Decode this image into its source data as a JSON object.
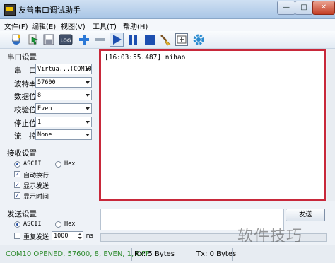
{
  "window": {
    "title": "友善串口调试助手",
    "controls": {
      "minimize": "—",
      "maximize": "□",
      "close": "✕"
    }
  },
  "menu": [
    "文件(F)",
    "编辑(E)",
    "视图(V)",
    "工具(T)",
    "帮助(H)"
  ],
  "toolbar": {
    "icons": [
      "new-doc-icon",
      "open-icon",
      "save-icon",
      "log-icon",
      "add-icon",
      "remove-icon",
      "play-icon",
      "pause-icon",
      "stop-icon",
      "clear-brush-icon",
      "add-window-icon",
      "settings-gear-icon"
    ],
    "log_label": "LOG"
  },
  "serial": {
    "title": "串口设置",
    "port": {
      "label": "串　口",
      "value": "Virtua...(COM10"
    },
    "baud": {
      "label": "波特率",
      "value": "57600"
    },
    "data_bits": {
      "label": "数据位",
      "value": "8"
    },
    "parity": {
      "label": "校验位",
      "value": "Even"
    },
    "stop_bits": {
      "label": "停止位",
      "value": "1"
    },
    "flow": {
      "label": "流　控",
      "value": "None"
    }
  },
  "receive": {
    "title": "接收设置",
    "ascii": "ASCII",
    "hex": "Hex",
    "auto_wrap": "自动换行",
    "show_send": "显示发送",
    "show_time": "显示时间",
    "log_line": "[16:03:55.487] nihao"
  },
  "send": {
    "title": "发送设置",
    "ascii": "ASCII",
    "hex": "Hex",
    "repeat": "重复发送",
    "interval": "1000",
    "unit": "ms",
    "button": "发送"
  },
  "status": {
    "port_status": "COM10 OPENED, 57600, 8, EVEN, 1, OFF",
    "rx": "Rx: 5 Bytes",
    "tx": "Tx: 0 Bytes"
  },
  "watermark": "软件技巧",
  "colors": {
    "highlight_border": "#c8283a",
    "status_green": "#2e8b2e"
  }
}
